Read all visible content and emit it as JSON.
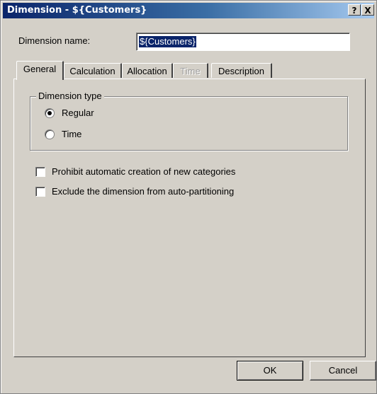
{
  "window": {
    "title": "Dimension - ${Customers}",
    "help_glyph": "?",
    "close_glyph": "X"
  },
  "dimension_name": {
    "label": "Dimension name:",
    "value": "${Customers}"
  },
  "tabs": [
    {
      "label": "General",
      "active": true,
      "enabled": true
    },
    {
      "label": "Calculation",
      "active": false,
      "enabled": true
    },
    {
      "label": "Allocation",
      "active": false,
      "enabled": true
    },
    {
      "label": "Time",
      "active": false,
      "enabled": false
    },
    {
      "label": "Description",
      "active": false,
      "enabled": true
    }
  ],
  "general": {
    "dimension_type": {
      "legend": "Dimension type",
      "options": [
        {
          "label": "Regular",
          "selected": true
        },
        {
          "label": "Time",
          "selected": false
        }
      ]
    },
    "checkboxes": [
      {
        "label": "Prohibit automatic creation of new categories",
        "checked": false
      },
      {
        "label": "Exclude the dimension from auto-partitioning",
        "checked": false
      }
    ]
  },
  "buttons": {
    "ok": "OK",
    "cancel": "Cancel"
  },
  "colors": {
    "title_gradient_start": "#0a246a",
    "title_gradient_end": "#a6caf0",
    "face": "#d4d0c8",
    "selection": "#0a246a"
  }
}
